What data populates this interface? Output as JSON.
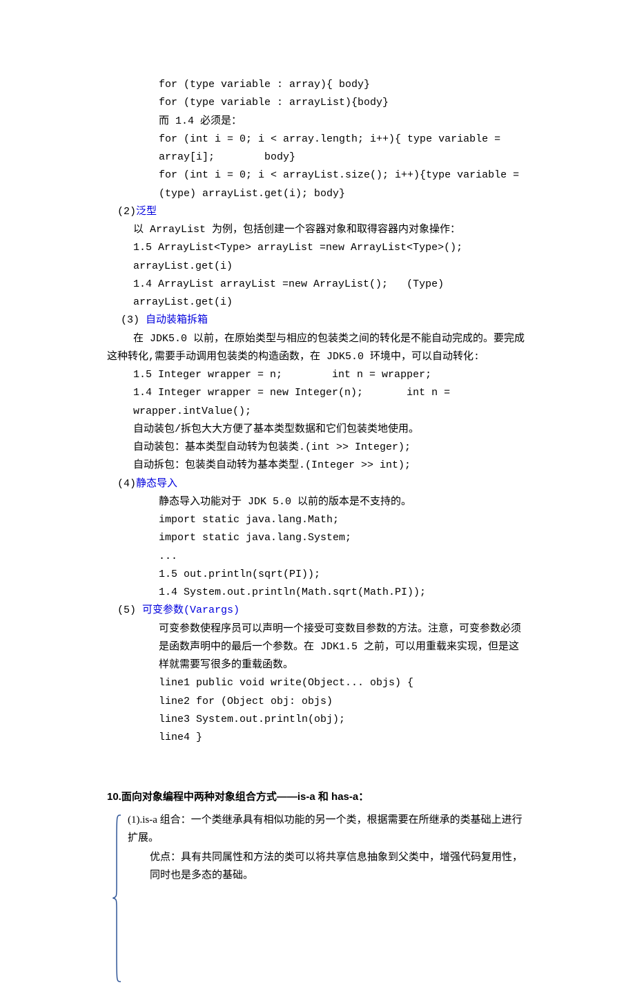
{
  "lines": {
    "l1": "for (type variable : array){ body}",
    "l2": "for (type variable : arrayList){body}",
    "l3": "而 1.4 必须是：",
    "l4": "for (int i = 0; i < array.length; i++){ type variable = array[i];        body}",
    "l5": "for (int i = 0; i < arrayList.size(); i++){type variable = (type) arrayList.get(i); body}",
    "g1a": "(2)",
    "g1b": "泛型",
    "l6": "以 ArrayList 为例，包括创建一个容器对象和取得容器内对象操作：",
    "l7": "1.5 ArrayList<Type> arrayList =new ArrayList<Type>(); arrayList.get(i)",
    "l8": "1.4 ArrayList arrayList =new ArrayList();   (Type) arrayList.get(i)",
    "g2a": "(3) ",
    "g2b": "自动装箱拆箱",
    "l9": "在 JDK5.0 以前，在原始类型与相应的包装类之间的转化是不能自动完成的。要完成这种转化,需要手动调用包装类的构造函数，在 JDK5.0 环境中，可以自动转化:",
    "l10": "1.5 Integer wrapper = n;        int n = wrapper;",
    "l11": "1.4 Integer wrapper = new Integer(n);       int n = wrapper.intValue();",
    "l12": "自动装包/拆包大大方便了基本类型数据和它们包装类地使用。",
    "l13": "自动装包：基本类型自动转为包装类.(int >> Integer);",
    "l14": "自动拆包：包装类自动转为基本类型.(Integer >> int);",
    "g3a": "(4)",
    "g3b": "静态导入",
    "l15": "静态导入功能对于 JDK 5.0 以前的版本是不支持的。",
    "l16": "import static java.lang.Math;",
    "l17": "import static java.lang.System;",
    "l18": "...",
    "l19": "1.5 out.println(sqrt(PI));",
    "l20": "1.4 System.out.println(Math.sqrt(Math.PI));",
    "g4a": "(5) ",
    "g4b": "可变参数(Varargs)",
    "l21": "可变参数使程序员可以声明一个接受可变数目参数的方法。注意，可变参数必须是函数声明中的最后一个参数。在 JDK1.5 之前，可以用重载来实现，但是这样就需要写很多的重载函数。",
    "l22": "line1 public void write(Object... objs) {",
    "l23": "line2 for (Object obj: objs)",
    "l24": "line3 System.out.println(obj);",
    "l25": "line4 }"
  },
  "heading": "10.面向对象编程中两种对象组合方式——is-a 和 has-a：",
  "sect": {
    "s1": "(1).is-a 组合：一个类继承具有相似功能的另一个类，根据需要在所继承的类基础上进行扩展。",
    "s2": "优点：具有共同属性和方法的类可以将共享信息抽象到父类中，增强代码复用性，同时也是多态的基础。"
  }
}
